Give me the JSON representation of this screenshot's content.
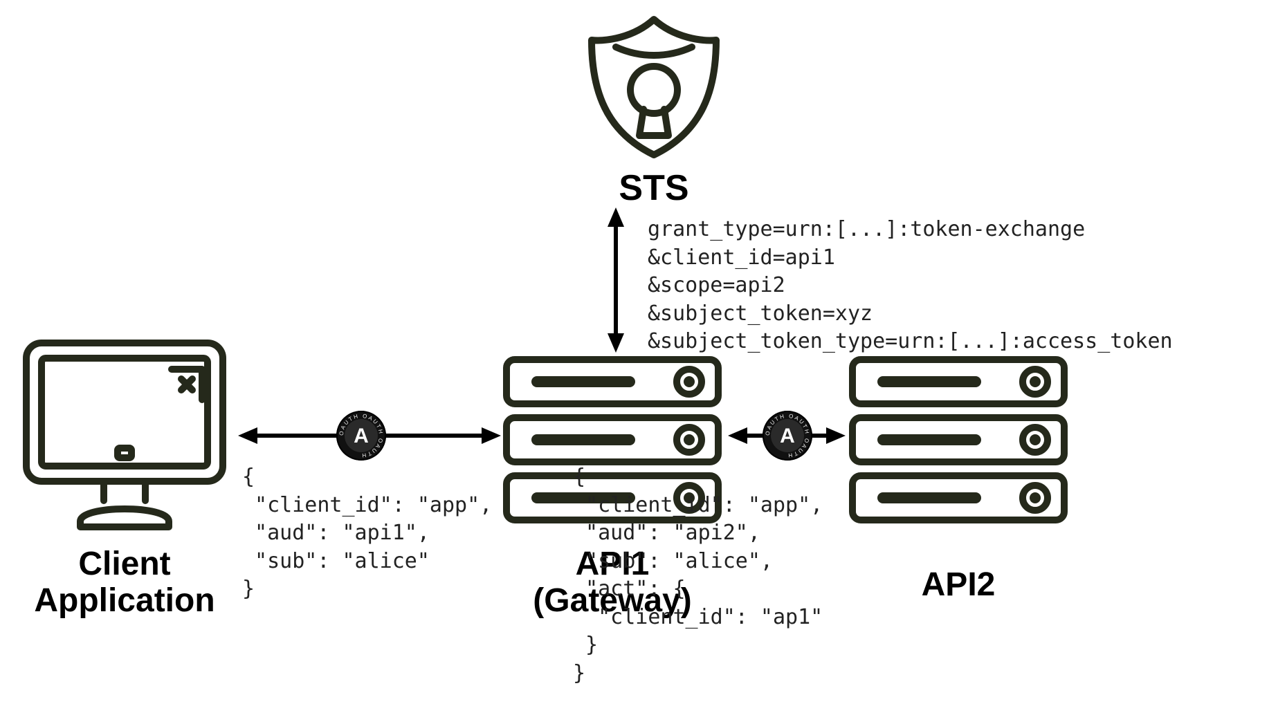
{
  "nodes": {
    "sts": {
      "label": "STS"
    },
    "client": {
      "label_line1": "Client",
      "label_line2": "Application"
    },
    "api1": {
      "label_line1": "API1",
      "label_line2": "(Gateway)"
    },
    "api2": {
      "label": "API2"
    }
  },
  "badges": {
    "oauth_initial": "A",
    "oauth_ring_text": "OAUTH · OAUTH · OAUTH · "
  },
  "requests": {
    "sts_exchange": "grant_type=urn:[...]:token-exchange\n&client_id=api1\n&scope=api2\n&subject_token=xyz\n&subject_token_type=urn:[...]:access_token",
    "token_client_to_api1": "{\n \"client_id\": \"app\",\n \"aud\": \"api1\",\n \"sub\": \"alice\"\n}",
    "token_api1_to_api2": "{\n \"client_id\": \"app\",\n \"aud\": \"api2\",\n \"sub\": \"alice\",\n \"act\": {\n  \"client_id\": \"ap1\"\n }\n}"
  }
}
